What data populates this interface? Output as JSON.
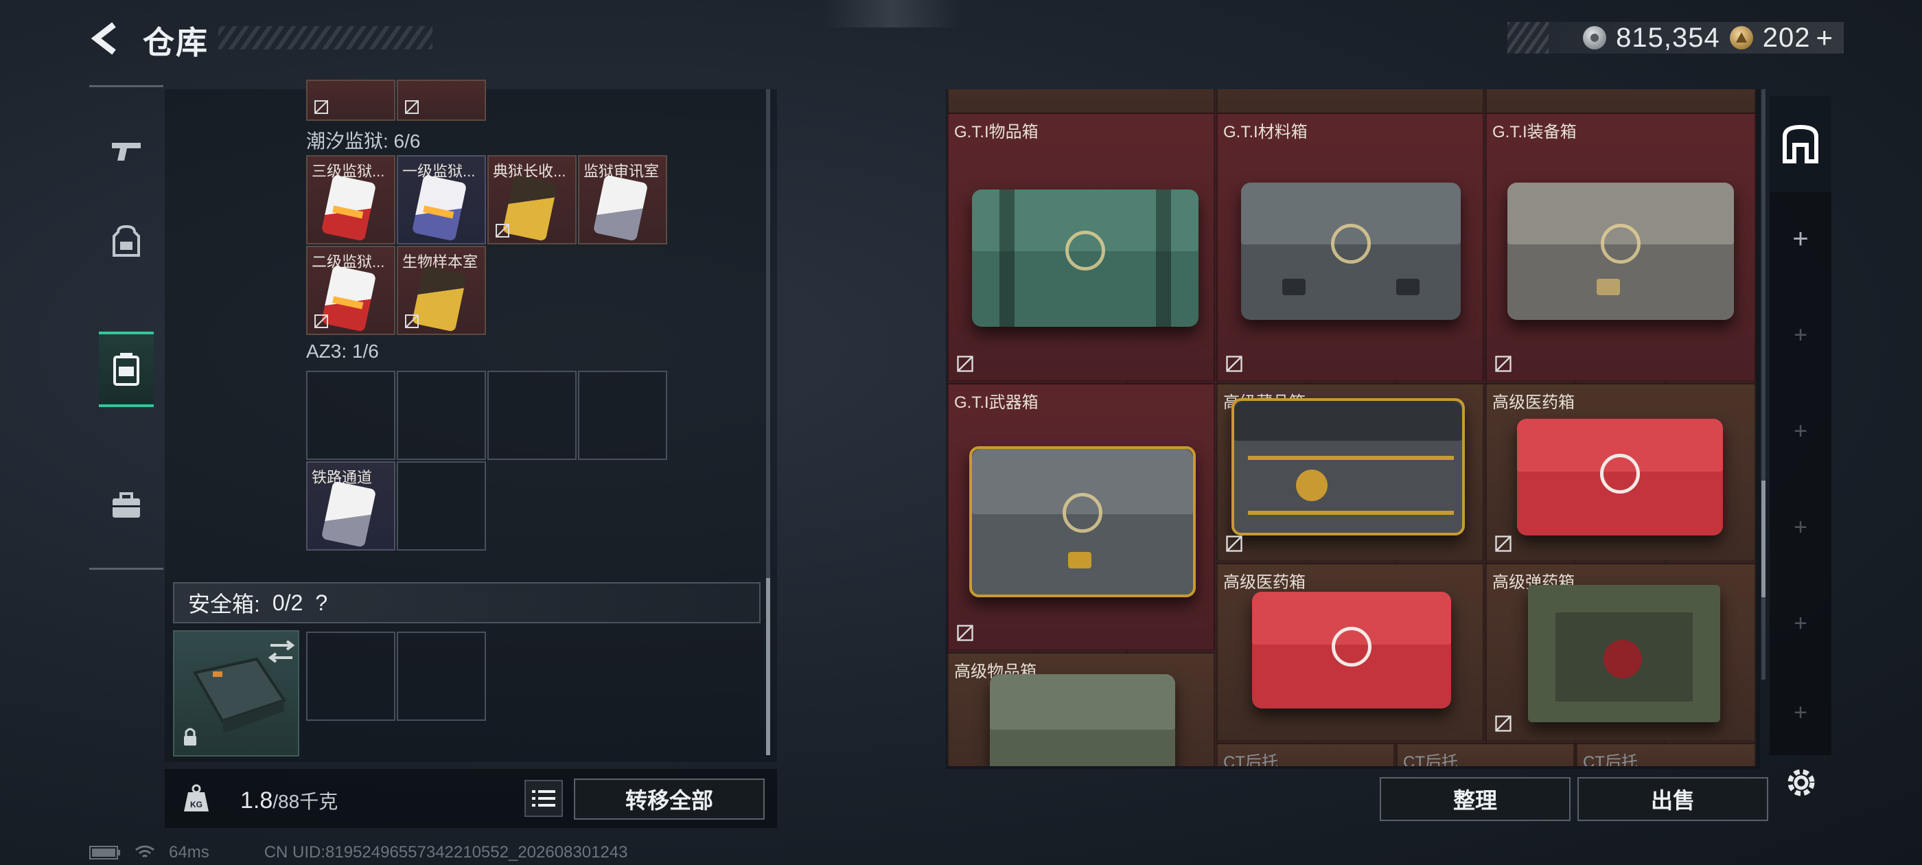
{
  "header": {
    "title": "仓库",
    "silver_amount": "815,354",
    "gold_amount": "202",
    "gold_plus": "+"
  },
  "categories": [
    {
      "icon": "pistol-icon"
    },
    {
      "icon": "backpack-icon"
    },
    {
      "icon": "container-icon",
      "active": true
    },
    {
      "icon": "briefcase-icon"
    }
  ],
  "inventory": {
    "groups": [
      {
        "label": "潮汐监狱: 6/6",
        "items": [
          {
            "name": "三级监狱...",
            "card": "red"
          },
          {
            "name": "一级监狱...",
            "card": "purple"
          },
          {
            "name": "典狱长收...",
            "card": "gold"
          },
          {
            "name": "监狱审讯室",
            "card": "white"
          },
          {
            "name": "二级监狱...",
            "card": "red"
          },
          {
            "name": "生物样本室",
            "card": "gold"
          }
        ]
      },
      {
        "label": "AZ3: 1/6",
        "items": [
          {
            "name": "铁路通道",
            "card": "white"
          }
        ]
      }
    ],
    "safebox_label": "安全箱:",
    "safebox_count": "0/2",
    "safebox_help": "?",
    "weight_value": "1.8",
    "weight_max": "/88千克",
    "weight_unit_icon": "KG",
    "transfer_all": "转移全部"
  },
  "storage": {
    "items": [
      {
        "name": "G.T.I物品箱",
        "color": "#3f6b5e"
      },
      {
        "name": "G.T.I材料箱",
        "color": "#4e5457"
      },
      {
        "name": "G.T.I装备箱",
        "color": "#6b6a66"
      },
      {
        "name": "G.T.I武器箱",
        "color": "#555a5e"
      },
      {
        "name": "高级藏品箱",
        "color": "#4b4f53"
      },
      {
        "name": "高级医药箱",
        "color": "#c3343c"
      },
      {
        "name": "高级医药箱",
        "color": "#c3343c"
      },
      {
        "name": "高级弹药箱",
        "color": "#4f5a45"
      },
      {
        "name": "高级物品箱",
        "color": "#56604f"
      }
    ],
    "dim_labels": [
      "CT后托",
      "CT后托",
      "CT后托"
    ],
    "sort_label": "整理",
    "sell_label": "出售"
  },
  "status": {
    "ping": "64ms",
    "uid": "CN UID:81952496557342210552_202608301243"
  },
  "colors": {
    "accent": "#35c59a",
    "item_bg_red": "#4a2a2b",
    "storage_bg": "#3a2226"
  }
}
